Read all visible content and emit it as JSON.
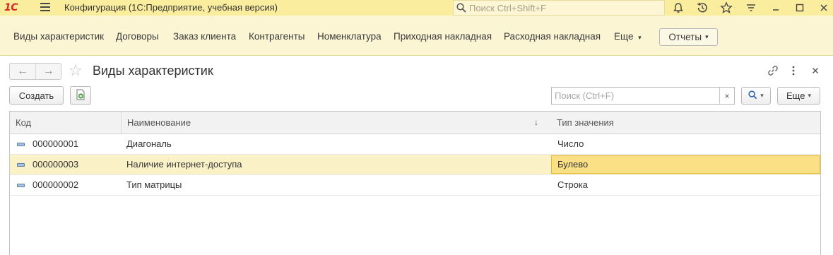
{
  "titlebar": {
    "logo_text": "1С",
    "app_title": "Конфигурация  (1С:Предприятие, учебная версия)",
    "search_placeholder": "Поиск Ctrl+Shift+F",
    "icons": [
      "bell-icon",
      "history-icon",
      "star-icon",
      "settings-icon",
      "minimize-icon",
      "maximize-icon",
      "close-icon"
    ]
  },
  "sections": {
    "items": [
      {
        "label": "Виды характеристик"
      },
      {
        "label": "Договоры"
      },
      {
        "label": "Заказ клиента"
      },
      {
        "label": "Контрагенты"
      },
      {
        "label": "Номенклатура"
      },
      {
        "label": "Приходная накладная"
      },
      {
        "label": "Расходная накладная"
      }
    ],
    "more_label": "Еще",
    "reports_label": "Отчеты"
  },
  "form": {
    "title": "Виды характеристик",
    "back_symbol": "←",
    "forward_symbol": "→",
    "create_label": "Создать",
    "search_placeholder": "Поиск (Ctrl+F)",
    "clear_symbol": "×",
    "more_label": "Еще"
  },
  "table": {
    "columns": [
      "Код",
      "Наименование",
      "Тип значения"
    ],
    "sort_indicator": "↓",
    "rows": [
      {
        "code": "000000001",
        "name": "Диагональ",
        "type": "Число",
        "selected": false
      },
      {
        "code": "000000003",
        "name": "Наличие интернет-доступа",
        "type": "Булево",
        "selected": true
      },
      {
        "code": "000000002",
        "name": "Тип матрицы",
        "type": "Строка",
        "selected": false
      }
    ]
  },
  "colors": {
    "titlebar_bg": "#fbed9e",
    "sections_bg": "#fbf5d4",
    "selected_row": "#fbf1c7",
    "current_cell": "#fbe086",
    "logo_red": "#d3281e"
  }
}
